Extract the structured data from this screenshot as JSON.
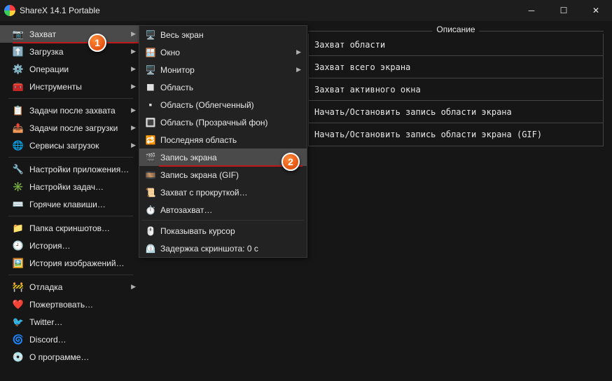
{
  "title": "ShareX 14.1 Portable",
  "sidebar": {
    "groups": [
      [
        {
          "icon": "📷",
          "label": "Захват",
          "arrow": true,
          "highlighted": true,
          "underline": true
        },
        {
          "icon": "⬆️",
          "label": "Загрузка",
          "arrow": true
        },
        {
          "icon": "⚙️",
          "label": "Операции",
          "arrow": true
        },
        {
          "icon": "🧰",
          "label": "Инструменты",
          "arrow": true
        }
      ],
      [
        {
          "icon": "📋",
          "label": "Задачи после захвата",
          "arrow": true
        },
        {
          "icon": "📤",
          "label": "Задачи после загрузки",
          "arrow": true
        },
        {
          "icon": "🌐",
          "label": "Сервисы загрузок",
          "arrow": true
        }
      ],
      [
        {
          "icon": "🔧",
          "label": "Настройки приложения…"
        },
        {
          "icon": "✳️",
          "label": "Настройки задач…"
        },
        {
          "icon": "⌨️",
          "label": "Горячие клавиши…"
        }
      ],
      [
        {
          "icon": "📁",
          "label": "Папка скриншотов…"
        },
        {
          "icon": "🕘",
          "label": "История…"
        },
        {
          "icon": "🖼️",
          "label": "История изображений…"
        }
      ],
      [
        {
          "icon": "🚧",
          "label": "Отладка",
          "arrow": true
        },
        {
          "icon": "❤️",
          "label": "Пожертвовать…"
        },
        {
          "icon": "🐦",
          "label": "Twitter…"
        },
        {
          "icon": "🌀",
          "label": "Discord…"
        },
        {
          "icon": "💿",
          "label": "О программе…"
        }
      ]
    ]
  },
  "submenu": {
    "groups": [
      [
        {
          "icon": "🖥️",
          "label": "Весь экран"
        },
        {
          "icon": "🪟",
          "label": "Окно",
          "arrow": true
        },
        {
          "icon": "🖥️",
          "label": "Монитор",
          "arrow": true
        },
        {
          "icon": "◻️",
          "label": "Область"
        },
        {
          "icon": "▫️",
          "label": "Область (Облегченный)"
        },
        {
          "icon": "🔳",
          "label": "Область (Прозрачный фон)"
        },
        {
          "icon": "🔁",
          "label": "Последняя область"
        },
        {
          "icon": "🎬",
          "label": "Запись экрана",
          "highlighted": true,
          "underline": true
        },
        {
          "icon": "🎞️",
          "label": "Запись экрана (GIF)"
        },
        {
          "icon": "📜",
          "label": "Захват с прокруткой…"
        },
        {
          "icon": "⏱️",
          "label": "Автозахват…"
        }
      ],
      [
        {
          "icon": "🖱️",
          "label": "Показывать курсор"
        },
        {
          "icon": "⏲️",
          "label": "Задержка скриншота: 0 с"
        }
      ]
    ]
  },
  "desc": {
    "title": "Описание",
    "items": [
      "Захват области",
      "Захват всего экрана",
      "Захват активного окна",
      "Начать/Остановить запись области экрана",
      "Начать/Остановить запись области экрана (GIF)"
    ]
  },
  "markers": [
    "1",
    "2"
  ]
}
